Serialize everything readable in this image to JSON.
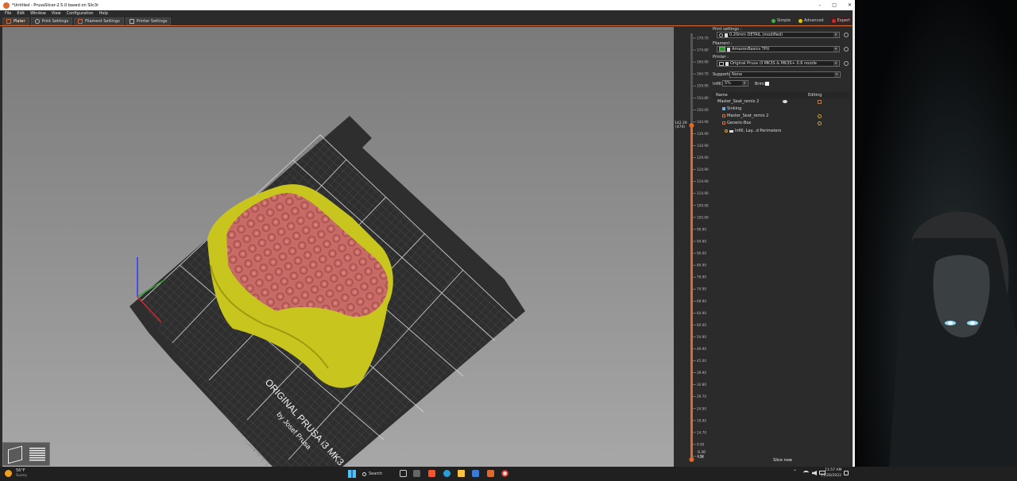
{
  "window": {
    "title": "*Untitled - PrusaSlicer-2.5.0 based on Slic3r",
    "minimize": "–",
    "maximize": "□",
    "close": "✕"
  },
  "menu": [
    "File",
    "Edit",
    "Window",
    "View",
    "Configuration",
    "Help"
  ],
  "tabs": [
    {
      "label": "Plater",
      "active": true
    },
    {
      "label": "Print Settings"
    },
    {
      "label": "Filament Settings"
    },
    {
      "label": "Printer Settings"
    }
  ],
  "modes": {
    "simple": "Simple",
    "advanced": "Advanced",
    "expert": "Expert",
    "colors": {
      "simple": "#3cb43c",
      "advanced": "#e6c800",
      "expert": "#d22828"
    }
  },
  "plate": {
    "text_line1": "ORIGINAL PRUSA i3 MK3",
    "text_line2": "by Josef Prusa"
  },
  "layer_slider": {
    "ticks": [
      "179.70",
      "174.80",
      "169.90",
      "164.70",
      "159.90",
      "154.80",
      "150.00",
      "144.90",
      "139.90",
      "134.90",
      "129.90",
      "124.90",
      "119.90",
      "114.90",
      "109.90",
      "105.00",
      "99.90",
      "94.80",
      "90.00",
      "84.90",
      "79.90",
      "74.90",
      "69.90",
      "64.90",
      "60.00",
      "54.90",
      "49.90",
      "45.00",
      "39.90",
      "34.80",
      "29.70",
      "24.90",
      "19.90",
      "14.70",
      "9.90",
      "4.90"
    ],
    "current_value": "142.29",
    "current_layer": "(474)",
    "bottom_value": "0.30",
    "bottom_layer": "(1)"
  },
  "sidebar": {
    "print_settings_label": "Print settings :",
    "print_settings_value": "0.20mm DETAIL (modified)",
    "filament_label": "Filament :",
    "filament_value": "AmazonBasics TPU",
    "filament_color": "#1ea01e",
    "printer_label": "Printer :",
    "printer_value": "Original Prusa i3 MK3S & MK3S+ 0.6 nozzle",
    "supports_label": "Supports:",
    "supports_value": "None",
    "infill_label": "Infill:",
    "infill_value": "5%",
    "brim_label": "Brim:",
    "table_col_name": "Name",
    "table_col_editing": "Editing",
    "objects": [
      {
        "label": "Master_Seat_remix 2",
        "indent": 0
      },
      {
        "label": "Sinking",
        "indent": 1
      },
      {
        "label": "Master_Seat_remix 2",
        "indent": 1
      },
      {
        "label": "Generic-Box",
        "indent": 1
      },
      {
        "label": "Infill, Lay...d Perimeters",
        "indent": 2
      }
    ],
    "slice_button": "Slice now"
  },
  "taskbar": {
    "weather_temp": "56°F",
    "weather_desc": "Sunny",
    "search": "Search",
    "time": "11:57 AM",
    "date": "11/28/2022"
  }
}
